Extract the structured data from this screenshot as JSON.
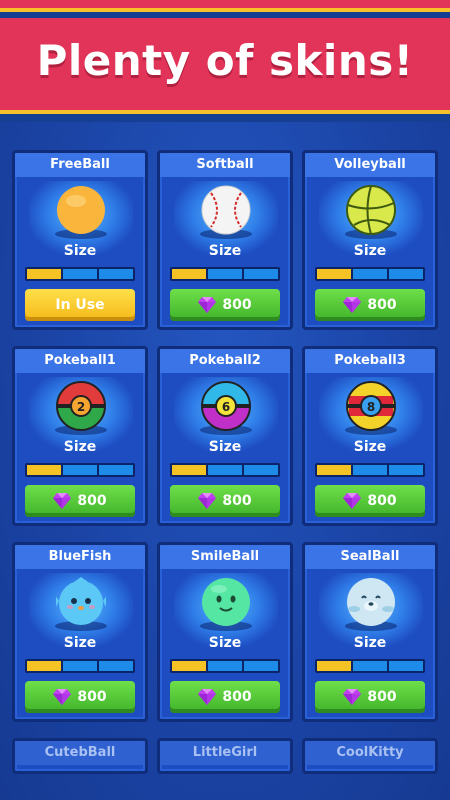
{
  "header": {
    "title": "Plenty of skins!"
  },
  "colors": {
    "banner_red": "#e23358",
    "banner_yellow": "#f6c12b",
    "card_blue": "#1e4dc2",
    "button_green": "#4fc33a",
    "button_yellow": "#f7c62a",
    "size_fill": "#f5c324",
    "size_empty": "#1e8be8"
  },
  "size_label": "Size",
  "skins": [
    {
      "name": "FreeBall",
      "icon": "orange-ball-icon",
      "size_level": 0.33,
      "button": "In Use",
      "state": "in-use"
    },
    {
      "name": "Softball",
      "icon": "baseball-icon",
      "size_level": 0.33,
      "price": "800",
      "state": "buy"
    },
    {
      "name": "Volleyball",
      "icon": "volleyball-icon",
      "size_level": 0.33,
      "price": "800",
      "state": "buy"
    },
    {
      "name": "Pokeball1",
      "icon": "pokeball-2-icon",
      "number": "2",
      "size_level": 0.33,
      "price": "800",
      "state": "buy"
    },
    {
      "name": "Pokeball2",
      "icon": "pokeball-6-icon",
      "number": "6",
      "size_level": 0.33,
      "price": "800",
      "state": "buy"
    },
    {
      "name": "Pokeball3",
      "icon": "pokeball-8-icon",
      "number": "8",
      "size_level": 0.33,
      "price": "800",
      "state": "buy"
    },
    {
      "name": "BlueFish",
      "icon": "bluefish-icon",
      "size_level": 0.33,
      "price": "800",
      "state": "buy"
    },
    {
      "name": "SmileBall",
      "icon": "smile-ball-icon",
      "size_level": 0.33,
      "price": "800",
      "state": "buy"
    },
    {
      "name": "SealBall",
      "icon": "seal-ball-icon",
      "size_level": 0.33,
      "price": "800",
      "state": "buy"
    }
  ],
  "partial_skins": [
    {
      "name": "CutebBall"
    },
    {
      "name": "LittleGirl"
    },
    {
      "name": "CoolKitty"
    }
  ]
}
